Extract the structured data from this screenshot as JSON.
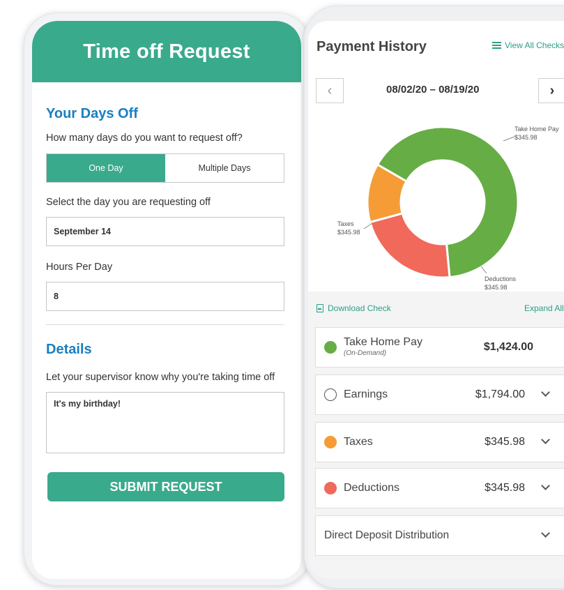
{
  "time_off": {
    "title": "Time off Request",
    "your_days_off": "Your Days Off",
    "question": "How many days do you want to request off?",
    "options": [
      "One Day",
      "Multiple Days"
    ],
    "selected_option": "One Day",
    "select_day_label": "Select the day you are requesting off",
    "day_value": "September 14",
    "hours_label": "Hours Per Day",
    "hours_value": "8",
    "details_title": "Details",
    "reason_label": "Let your supervisor know why you're taking time off",
    "reason_value": "It's my birthday!",
    "submit_label": "SUBMIT REQUEST"
  },
  "payment_history": {
    "title": "Payment History",
    "view_all_label": "View All Checks",
    "prev_icon": "chevron-left-icon",
    "next_icon": "chevron-right-icon",
    "date_range": "08/02/20 – 08/19/20",
    "download_label": "Download Check",
    "expand_label": "Expand All",
    "donut": {
      "segments": [
        {
          "name": "Take Home Pay",
          "value": 0.652,
          "color": "#66ad45",
          "label": "Take Home Pay",
          "amount": "$345.98"
        },
        {
          "name": "Deductions",
          "value": 0.222,
          "color": "#f0695a",
          "label": "Deductions",
          "amount": "$345.98"
        },
        {
          "name": "Taxes",
          "value": 0.126,
          "color": "#f59c37",
          "label": "Taxes",
          "amount": "$345.98"
        }
      ]
    },
    "cards": [
      {
        "label": "Take Home Pay",
        "sublabel": "(On-Demand)",
        "amount": "$1,424.00",
        "color": "#66ad45"
      },
      {
        "label": "Earnings",
        "amount": "$1,794.00",
        "color": "outline"
      },
      {
        "label": "Taxes",
        "amount": "$345.98",
        "color": "#f59c37"
      },
      {
        "label": "Deductions",
        "amount": "$345.98",
        "color": "#f0695a"
      },
      {
        "label": "Direct Deposit Distribution"
      }
    ]
  }
}
